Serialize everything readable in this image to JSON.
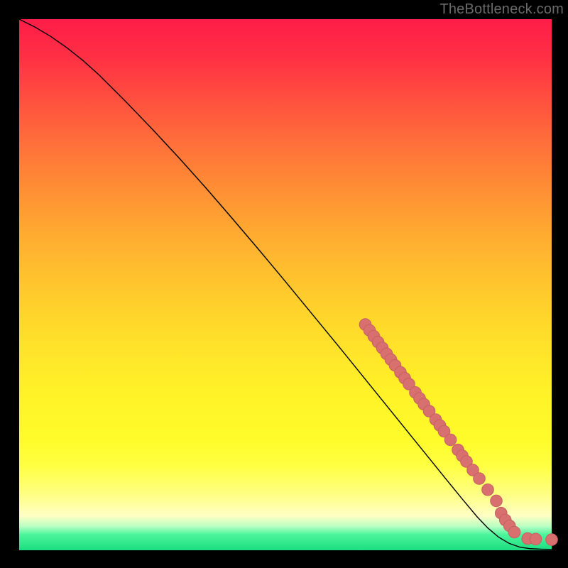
{
  "watermark": "TheBottleneck.com",
  "colors": {
    "curve_stroke": "#000000",
    "dot_fill": "#d97070",
    "dot_stroke": "#c86262"
  },
  "chart_data": {
    "type": "line",
    "title": "",
    "xlabel": "",
    "ylabel": "",
    "xlim": [
      0,
      100
    ],
    "ylim": [
      0,
      100
    ],
    "series": [
      {
        "name": "curve",
        "x": [
          0,
          3,
          6,
          9,
          12,
          15,
          20,
          25,
          30,
          35,
          40,
          45,
          50,
          55,
          60,
          65,
          70,
          75,
          80,
          83,
          86,
          88,
          90,
          92,
          94,
          96,
          98,
          100
        ],
        "y": [
          100,
          98.5,
          96.7,
          94.6,
          92.2,
          89.5,
          84.5,
          79.3,
          73.9,
          68.3,
          62.5,
          56.6,
          50.6,
          44.5,
          38.4,
          32.2,
          26.0,
          19.8,
          13.6,
          9.9,
          6.3,
          4.2,
          2.5,
          1.3,
          0.6,
          0.3,
          0.2,
          0.15
        ]
      }
    ],
    "dots": {
      "name": "markers",
      "points": [
        {
          "x": 65.0,
          "y": 42.5
        },
        {
          "x": 65.8,
          "y": 41.4
        },
        {
          "x": 66.6,
          "y": 40.3
        },
        {
          "x": 67.4,
          "y": 39.2
        },
        {
          "x": 68.2,
          "y": 38.1
        },
        {
          "x": 69.0,
          "y": 37.0
        },
        {
          "x": 69.8,
          "y": 35.9
        },
        {
          "x": 70.6,
          "y": 34.8
        },
        {
          "x": 71.6,
          "y": 33.5
        },
        {
          "x": 72.4,
          "y": 32.4
        },
        {
          "x": 73.2,
          "y": 31.3
        },
        {
          "x": 74.4,
          "y": 29.7
        },
        {
          "x": 75.2,
          "y": 28.6
        },
        {
          "x": 76.0,
          "y": 27.5
        },
        {
          "x": 77.0,
          "y": 26.2
        },
        {
          "x": 78.2,
          "y": 24.6
        },
        {
          "x": 79.0,
          "y": 23.5
        },
        {
          "x": 79.8,
          "y": 22.4
        },
        {
          "x": 81.0,
          "y": 20.8
        },
        {
          "x": 82.4,
          "y": 18.9
        },
        {
          "x": 83.2,
          "y": 17.8
        },
        {
          "x": 84.0,
          "y": 16.7
        },
        {
          "x": 85.2,
          "y": 15.1
        },
        {
          "x": 86.4,
          "y": 13.5
        },
        {
          "x": 88.0,
          "y": 11.4
        },
        {
          "x": 89.6,
          "y": 9.3
        },
        {
          "x": 90.5,
          "y": 7.0
        },
        {
          "x": 91.3,
          "y": 5.7
        },
        {
          "x": 92.1,
          "y": 4.6
        },
        {
          "x": 93.0,
          "y": 3.4
        },
        {
          "x": 95.5,
          "y": 2.2
        },
        {
          "x": 97.0,
          "y": 2.1
        },
        {
          "x": 100.0,
          "y": 2.0
        }
      ],
      "radius": 1.1
    }
  }
}
